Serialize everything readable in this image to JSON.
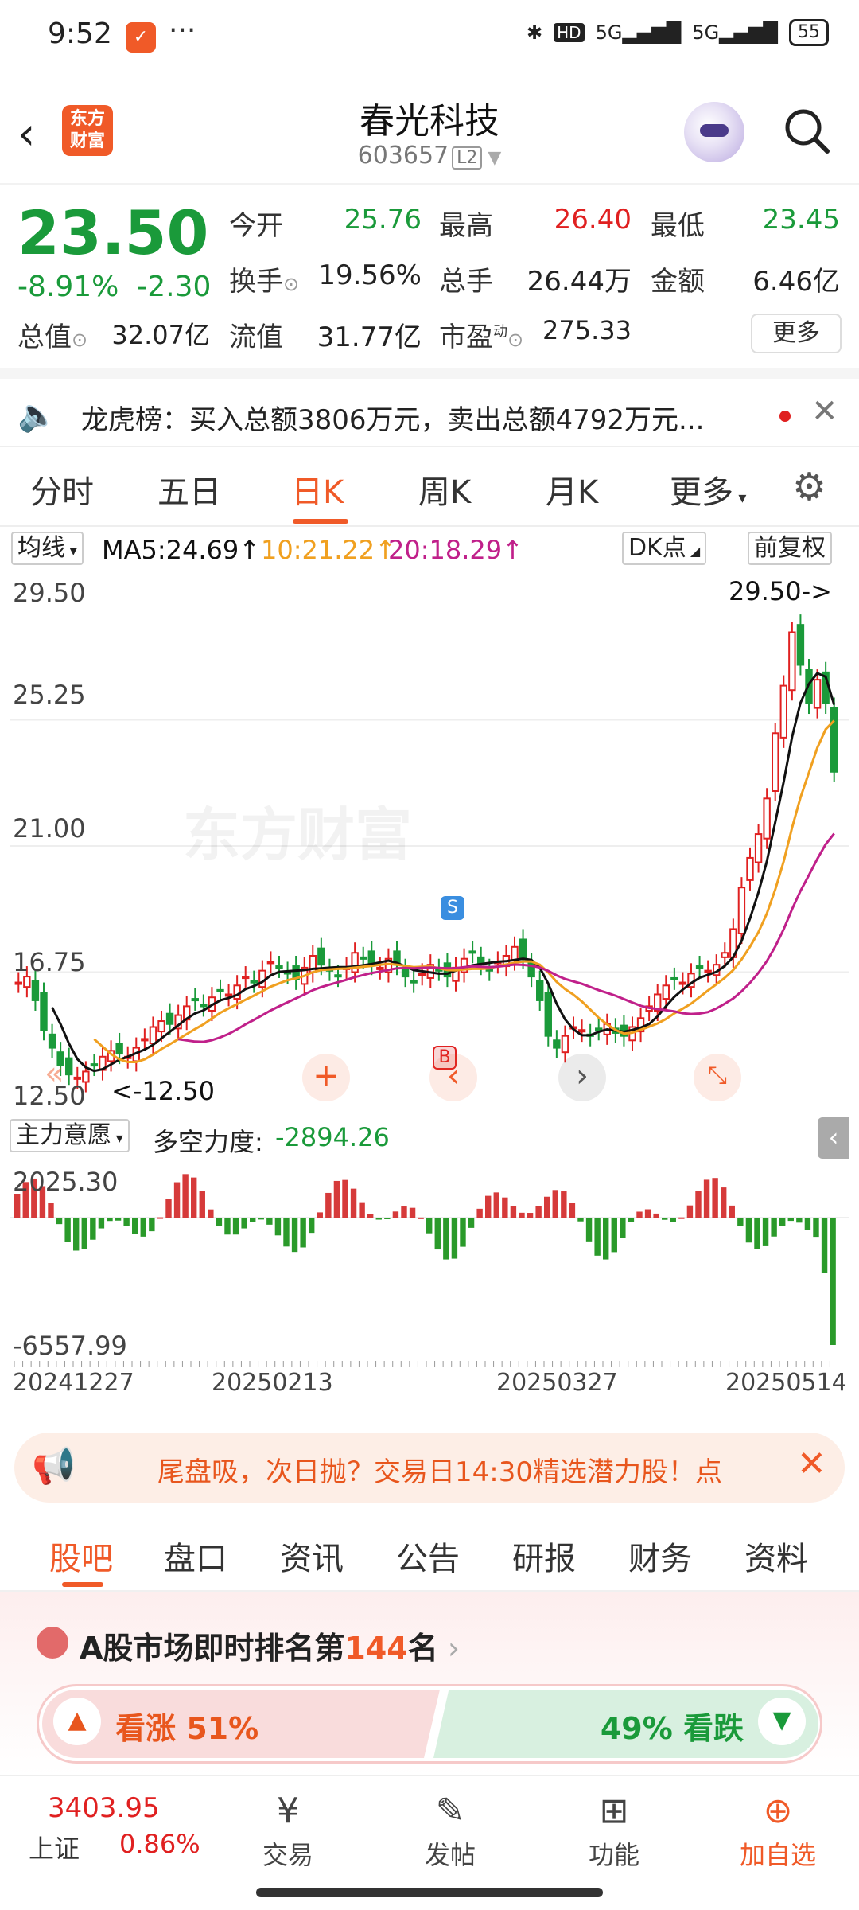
{
  "status_bar": {
    "time": "9:52",
    "dots": "···",
    "network_1": "5G",
    "network_2": "5G",
    "battery": "55"
  },
  "header": {
    "logo_text": "东方财富",
    "stock_name": "春光科技",
    "stock_code": "603657",
    "level_badge": "L2"
  },
  "quote": {
    "price": "23.50",
    "change_pct": "-8.91%",
    "change_amt": "-2.30",
    "fields": [
      {
        "label": "今开",
        "value": "25.76",
        "color": "green"
      },
      {
        "label": "最高",
        "value": "26.40",
        "color": "red"
      },
      {
        "label": "最低",
        "value": "23.45",
        "color": "green"
      },
      {
        "label": "换手",
        "value": "19.56%",
        "color": "black"
      },
      {
        "label": "总手",
        "value": "26.44万",
        "color": "black"
      },
      {
        "label": "金额",
        "value": "6.46亿",
        "color": "black"
      },
      {
        "label": "总值",
        "value": "32.07亿",
        "color": "black"
      },
      {
        "label": "流值",
        "value": "31.77亿",
        "color": "black"
      },
      {
        "label": "市盈",
        "value": "275.33",
        "color": "black"
      }
    ],
    "pe_superscript": "动",
    "more_label": "更多"
  },
  "notice": {
    "text": "龙虎榜：买入总额3806万元，卖出总额4792万元..."
  },
  "chart_tabs": [
    "分时",
    "五日",
    "日K",
    "周K",
    "月K",
    "更多"
  ],
  "chart_tabs_active": "日K",
  "ma_bar": {
    "selector": "均线",
    "ma5": "MA5:24.69↑",
    "ma10": "10:21.22↑",
    "ma20": "20:18.29↑",
    "dk": "DK点",
    "adjust": "前复权"
  },
  "chart_data": {
    "type": "candlestick",
    "ylim": [
      12.5,
      29.5
    ],
    "y_ticks": [
      "29.50",
      "25.25",
      "21.00",
      "16.75",
      "12.50"
    ],
    "max_marker": "29.50->",
    "min_marker": "<-12.50",
    "signal_s": "S",
    "signal_b": "B",
    "watermark": "东方财富",
    "ma_colors": {
      "ma5": "#111111",
      "ma10": "#f0a020",
      "ma20": "#c0208a"
    },
    "up_color": "#e02020",
    "down_color": "#1a9a3a",
    "x_labels": [
      "20241227",
      "20250213",
      "20250327",
      "20250514"
    ]
  },
  "indicator": {
    "selector": "主力意愿",
    "label": "多空力度:",
    "value": "-2894.26",
    "ymax": "2025.30",
    "ymin": "-6557.99"
  },
  "promo": {
    "text": "尾盘吸，次日抛？交易日14:30精选潜力股！点"
  },
  "section_tabs": [
    "股吧",
    "盘口",
    "资讯",
    "公告",
    "研报",
    "财务",
    "资料"
  ],
  "section_tabs_active": "股吧",
  "rank": {
    "prefix": "A股市场即时排名第",
    "number": "144",
    "suffix": "名"
  },
  "vote": {
    "up_label": "看涨 51%",
    "down_label": "49% 看跌",
    "up_pct": 51
  },
  "bottom_nav": {
    "index_value": "3403.95",
    "index_name": "上证",
    "index_change": "0.86%",
    "items": [
      {
        "label": "交易",
        "icon": "yuan-icon"
      },
      {
        "label": "发帖",
        "icon": "edit-icon"
      },
      {
        "label": "功能",
        "icon": "grid-icon"
      },
      {
        "label": "加自选",
        "icon": "add-icon"
      }
    ]
  }
}
